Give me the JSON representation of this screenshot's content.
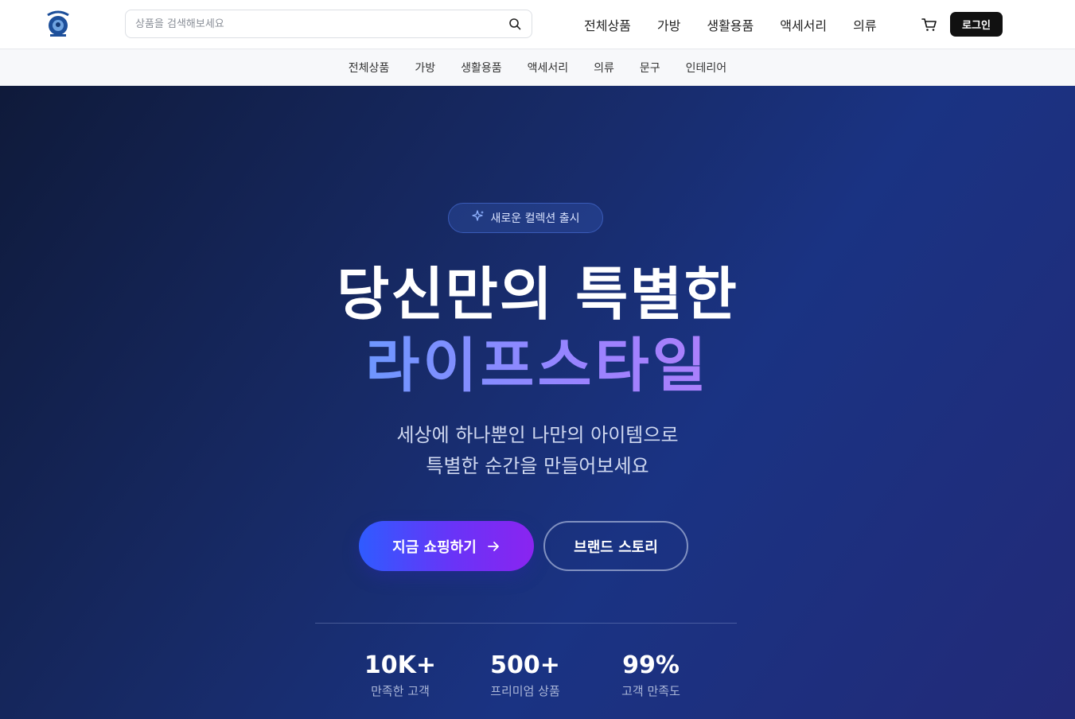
{
  "header": {
    "logo_name": "sanggyu-logo",
    "search": {
      "placeholder": "상품을 검색해보세요",
      "value": ""
    },
    "nav": [
      "전체상품",
      "가방",
      "생활용품",
      "액세서리",
      "의류"
    ],
    "login_label": "로그인"
  },
  "category_bar": [
    "전체상품",
    "가방",
    "생활용품",
    "액세서리",
    "의류",
    "문구",
    "인테리어"
  ],
  "hero": {
    "badge": "새로운 컬렉션 출시",
    "headline_line1": "당신만의 특별한",
    "headline_line2": "라이프스타일",
    "subtitle_line1": "세상에 하나뿐인 나만의 아이템으로",
    "subtitle_line2": "특별한 순간을 만들어보세요",
    "primary_cta": "지금 쇼핑하기",
    "secondary_cta": "브랜드 스토리",
    "stats": [
      {
        "value": "10K+",
        "label": "만족한 고객"
      },
      {
        "value": "500+",
        "label": "프리미엄 상품"
      },
      {
        "value": "99%",
        "label": "고객 만족도"
      }
    ]
  },
  "colors": {
    "accent_start": "#2f5bff",
    "accent_end": "#8a24f0",
    "hero_bg": "#172a66",
    "login_bg": "#111111"
  }
}
